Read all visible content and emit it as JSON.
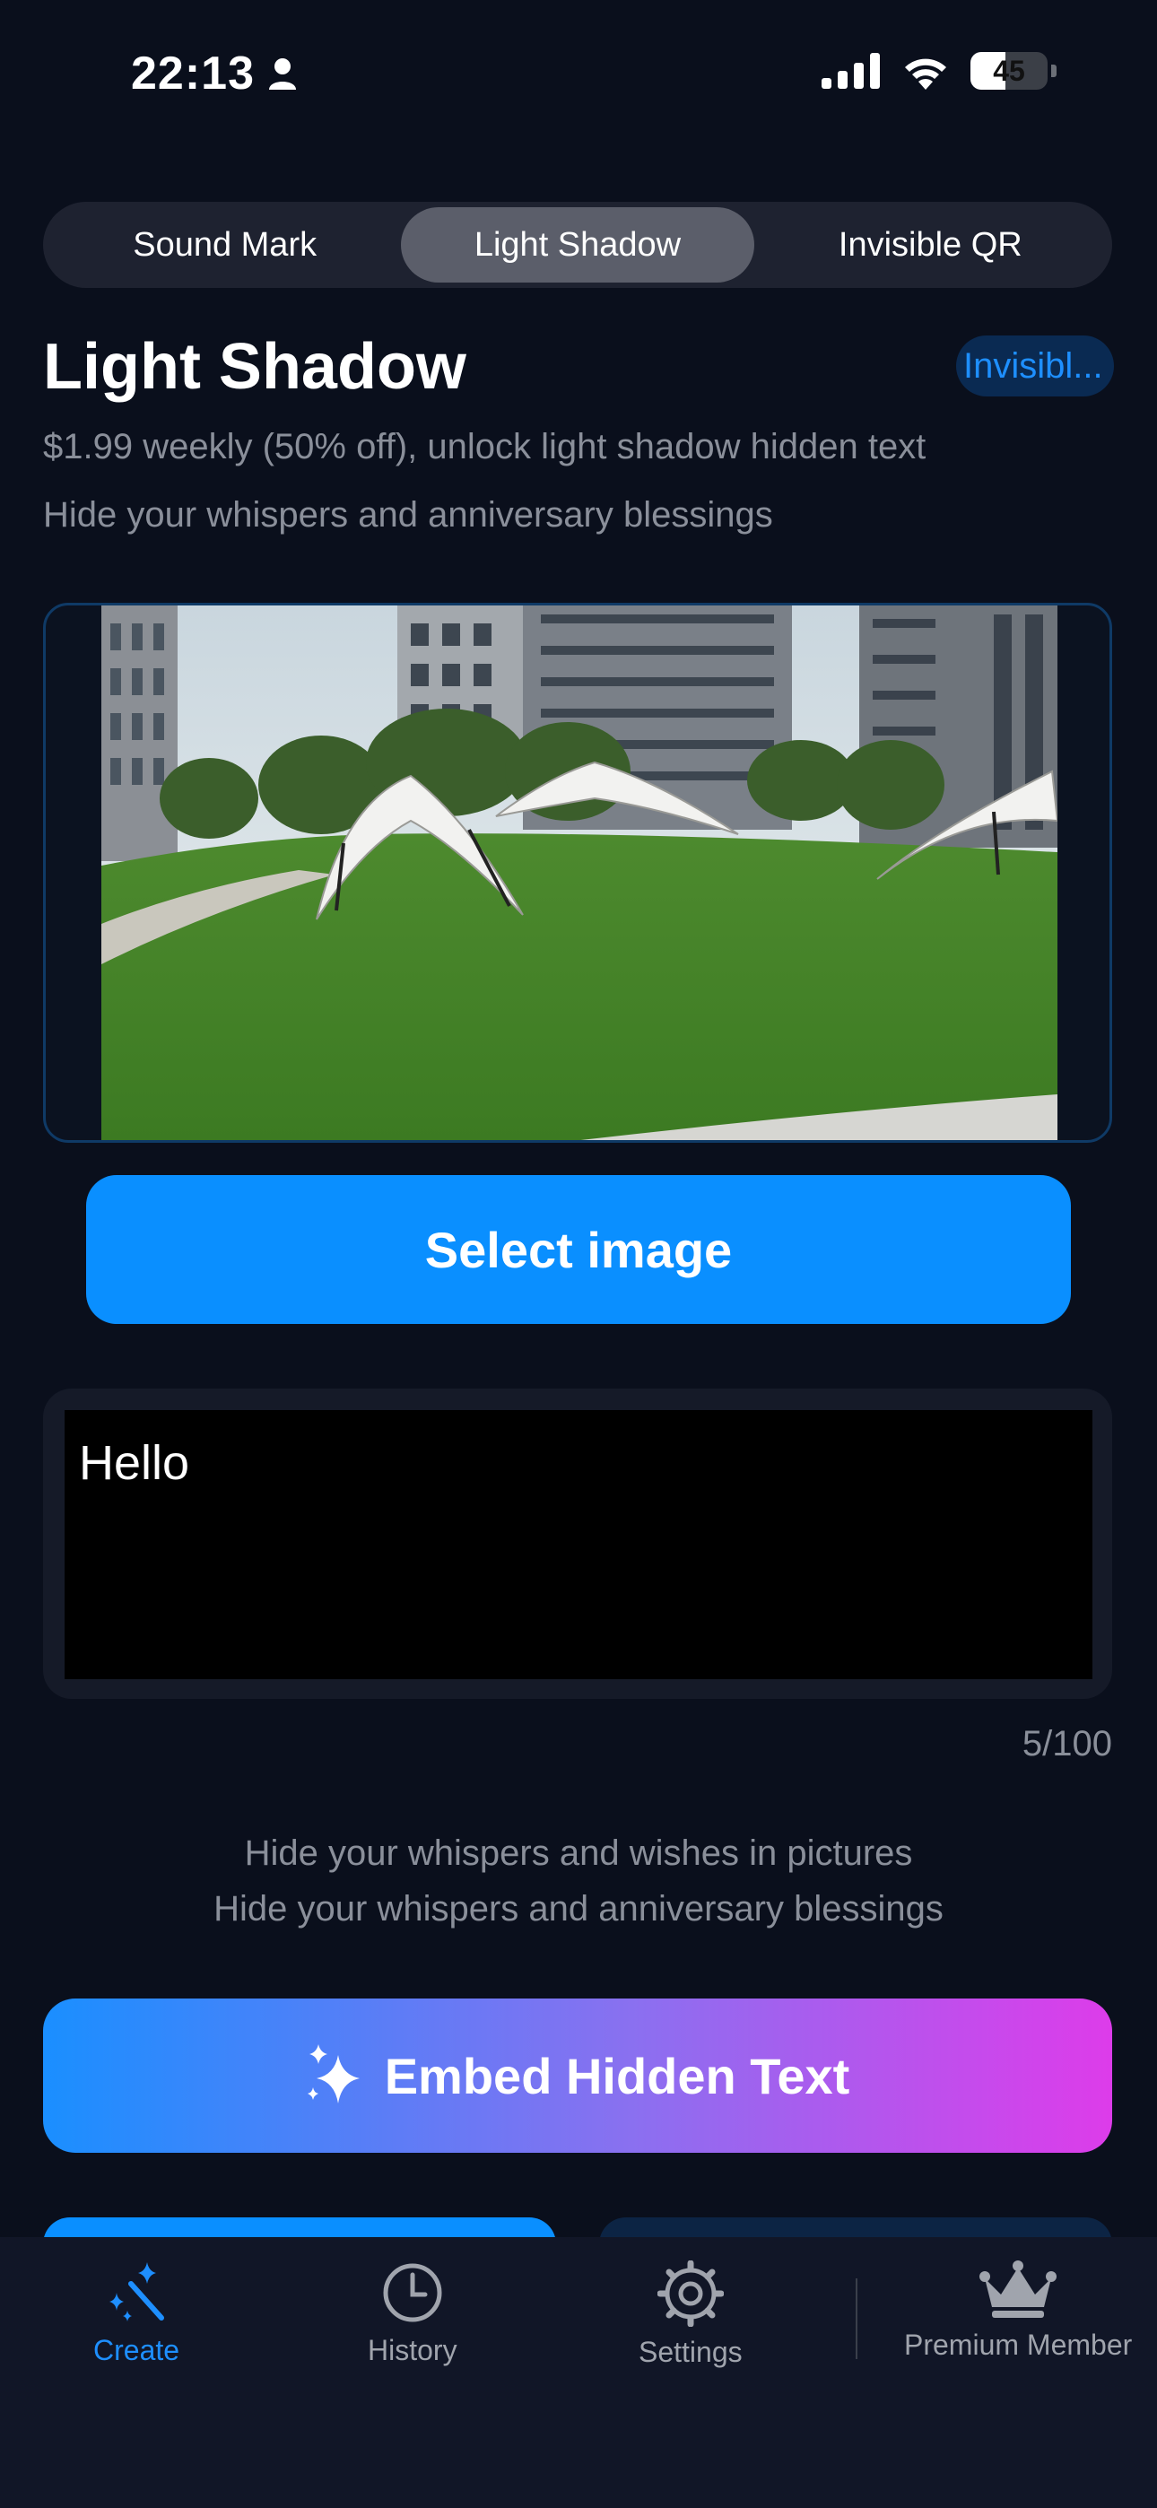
{
  "status_bar": {
    "time": "22:13",
    "battery": "45"
  },
  "segments": [
    {
      "label": "Sound Mark",
      "active": false
    },
    {
      "label": "Light Shadow",
      "active": true
    },
    {
      "label": "Invisible QR",
      "active": false
    }
  ],
  "header": {
    "title": "Light Shadow",
    "badge": "Invisibl...",
    "price_line": "$1.99 weekly (50% off), unlock light shadow hidden text",
    "tagline": "Hide your whispers and anniversary blessings"
  },
  "select_image_label": "Select image",
  "text_input": {
    "value": "Hello",
    "counter": "5/100"
  },
  "hints": {
    "line1": "Hide your whispers and wishes in pictures",
    "line2": "Hide your whispers and anniversary blessings"
  },
  "embed_button_label": "Embed Hidden Text",
  "tabbar": {
    "create": "Create",
    "history": "History",
    "settings": "Settings",
    "premium": "Premium Member"
  },
  "colors": {
    "accent": "#0a8fff",
    "background": "#0a0f1c"
  }
}
